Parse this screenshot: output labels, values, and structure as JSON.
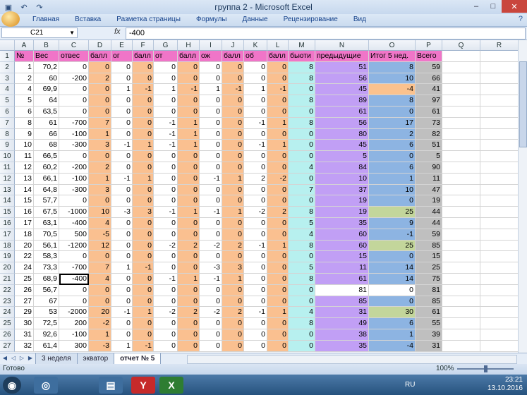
{
  "window": {
    "title": "группа 2 - Microsoft Excel"
  },
  "ribbon": {
    "tabs": [
      "Главная",
      "Вставка",
      "Разметка страницы",
      "Формулы",
      "Данные",
      "Рецензирование",
      "Вид"
    ]
  },
  "formula_bar": {
    "name_box": "C21",
    "fx": "fx",
    "value": "-400"
  },
  "columns": [
    "A",
    "B",
    "C",
    "D",
    "E",
    "F",
    "G",
    "H",
    "I",
    "J",
    "K",
    "L",
    "M",
    "N",
    "O",
    "P",
    "Q",
    "R"
  ],
  "colors": {
    "orange": "#fac090",
    "cyan": "#b7f0ef",
    "purple": "#c19ff5",
    "blue": "#8db4e2",
    "gray": "#bfbfbf",
    "pink": "#f075c8",
    "lightorange": "#fbc28e",
    "green": "#c3d69b"
  },
  "header_row": [
    "№",
    "Вес",
    "отвес",
    "балл",
    "ог",
    "балл",
    "от",
    "балл",
    "ож",
    "балл",
    "об",
    "балл",
    "бьюти",
    "предыдущие",
    "Итог 5 нед.",
    "Всего",
    "",
    ""
  ],
  "rows": [
    {
      "n": "2",
      "v": [
        "1",
        "70,2",
        "0",
        "0",
        "0",
        "0",
        "0",
        "0",
        "0",
        "0",
        "0",
        "0",
        "8",
        "51",
        "8",
        "59"
      ]
    },
    {
      "n": "3",
      "v": [
        "2",
        "60",
        "-200",
        "2",
        "0",
        "0",
        "0",
        "0",
        "0",
        "0",
        "0",
        "0",
        "8",
        "56",
        "10",
        "66"
      ]
    },
    {
      "n": "4",
      "v": [
        "4",
        "69,9",
        "0",
        "0",
        "1",
        "-1",
        "1",
        "-1",
        "1",
        "-1",
        "1",
        "-1",
        "0",
        "45",
        "-4",
        "41"
      ]
    },
    {
      "n": "5",
      "v": [
        "5",
        "64",
        "0",
        "0",
        "0",
        "0",
        "0",
        "0",
        "0",
        "0",
        "0",
        "0",
        "8",
        "89",
        "8",
        "97"
      ]
    },
    {
      "n": "6",
      "v": [
        "6",
        "63,5",
        "0",
        "0",
        "0",
        "0",
        "0",
        "0",
        "0",
        "0",
        "0",
        "0",
        "0",
        "61",
        "0",
        "61"
      ]
    },
    {
      "n": "7",
      "v": [
        "8",
        "61",
        "-700",
        "7",
        "0",
        "0",
        "-1",
        "1",
        "0",
        "0",
        "-1",
        "1",
        "8",
        "56",
        "17",
        "73"
      ]
    },
    {
      "n": "8",
      "v": [
        "9",
        "66",
        "-100",
        "1",
        "0",
        "0",
        "-1",
        "1",
        "0",
        "0",
        "0",
        "0",
        "0",
        "80",
        "2",
        "82"
      ]
    },
    {
      "n": "9",
      "v": [
        "10",
        "68",
        "-300",
        "3",
        "-1",
        "1",
        "-1",
        "1",
        "0",
        "0",
        "-1",
        "1",
        "0",
        "45",
        "6",
        "51"
      ]
    },
    {
      "n": "10",
      "v": [
        "11",
        "66,5",
        "0",
        "0",
        "0",
        "0",
        "0",
        "0",
        "0",
        "0",
        "0",
        "0",
        "0",
        "5",
        "0",
        "5"
      ]
    },
    {
      "n": "11",
      "v": [
        "12",
        "60,2",
        "-200",
        "2",
        "0",
        "0",
        "0",
        "0",
        "0",
        "0",
        "0",
        "0",
        "4",
        "84",
        "6",
        "90"
      ]
    },
    {
      "n": "12",
      "v": [
        "13",
        "66,1",
        "-100",
        "1",
        "-1",
        "1",
        "0",
        "0",
        "-1",
        "1",
        "2",
        "-2",
        "0",
        "10",
        "1",
        "11"
      ]
    },
    {
      "n": "13",
      "v": [
        "14",
        "64,8",
        "-300",
        "3",
        "0",
        "0",
        "0",
        "0",
        "0",
        "0",
        "0",
        "0",
        "7",
        "37",
        "10",
        "47"
      ]
    },
    {
      "n": "14",
      "v": [
        "15",
        "57,7",
        "0",
        "0",
        "0",
        "0",
        "0",
        "0",
        "0",
        "0",
        "0",
        "0",
        "0",
        "19",
        "0",
        "19"
      ]
    },
    {
      "n": "15",
      "v": [
        "16",
        "67,5",
        "-1000",
        "10",
        "-3",
        "3",
        "-1",
        "1",
        "-1",
        "1",
        "-2",
        "2",
        "8",
        "19",
        "25",
        "44"
      ]
    },
    {
      "n": "16",
      "v": [
        "17",
        "63,1",
        "-400",
        "4",
        "0",
        "0",
        "0",
        "0",
        "0",
        "0",
        "0",
        "0",
        "5",
        "35",
        "9",
        "44"
      ]
    },
    {
      "n": "17",
      "v": [
        "18",
        "70,5",
        "500",
        "-5",
        "0",
        "0",
        "0",
        "0",
        "0",
        "0",
        "0",
        "0",
        "4",
        "60",
        "-1",
        "59"
      ]
    },
    {
      "n": "18",
      "v": [
        "20",
        "56,1",
        "-1200",
        "12",
        "0",
        "0",
        "-2",
        "2",
        "-2",
        "2",
        "-1",
        "1",
        "8",
        "60",
        "25",
        "85"
      ]
    },
    {
      "n": "19",
      "v": [
        "22",
        "58,3",
        "0",
        "0",
        "0",
        "0",
        "0",
        "0",
        "0",
        "0",
        "0",
        "0",
        "0",
        "15",
        "0",
        "15"
      ]
    },
    {
      "n": "20",
      "v": [
        "24",
        "73,3",
        "-700",
        "7",
        "1",
        "-1",
        "0",
        "0",
        "-3",
        "3",
        "0",
        "0",
        "5",
        "11",
        "14",
        "25"
      ]
    },
    {
      "n": "21",
      "v": [
        "25",
        "68,9",
        "-400",
        "4",
        "0",
        "0",
        "-1",
        "1",
        "-1",
        "1",
        "0",
        "0",
        "8",
        "61",
        "14",
        "75"
      ]
    },
    {
      "n": "22",
      "v": [
        "26",
        "56,7",
        "0",
        "0",
        "0",
        "0",
        "0",
        "0",
        "0",
        "0",
        "0",
        "0",
        "0",
        "81",
        "0",
        "81"
      ]
    },
    {
      "n": "23",
      "v": [
        "27",
        "67",
        "0",
        "0",
        "0",
        "0",
        "0",
        "0",
        "0",
        "0",
        "0",
        "0",
        "0",
        "85",
        "0",
        "85"
      ]
    },
    {
      "n": "24",
      "v": [
        "29",
        "53",
        "-2000",
        "20",
        "-1",
        "1",
        "-2",
        "2",
        "-2",
        "2",
        "-1",
        "1",
        "4",
        "31",
        "30",
        "61"
      ]
    },
    {
      "n": "25",
      "v": [
        "30",
        "72,5",
        "200",
        "-2",
        "0",
        "0",
        "0",
        "0",
        "0",
        "0",
        "0",
        "0",
        "8",
        "49",
        "6",
        "55"
      ]
    },
    {
      "n": "26",
      "v": [
        "31",
        "92,6",
        "-100",
        "1",
        "0",
        "0",
        "0",
        "0",
        "0",
        "0",
        "0",
        "0",
        "0",
        "38",
        "1",
        "39"
      ]
    },
    {
      "n": "27",
      "v": [
        "32",
        "61,4",
        "300",
        "-3",
        "1",
        "-1",
        "0",
        "0",
        "0",
        "0",
        "0",
        "0",
        "0",
        "35",
        "-4",
        "31"
      ]
    }
  ],
  "sheets": [
    "3 неделя",
    "экватор",
    "отчет № 5"
  ],
  "status": {
    "ready": "Готово",
    "zoom": "100%"
  },
  "taskbar": {
    "lang": "RU",
    "time": "23:21",
    "date": "13.10.2016"
  }
}
